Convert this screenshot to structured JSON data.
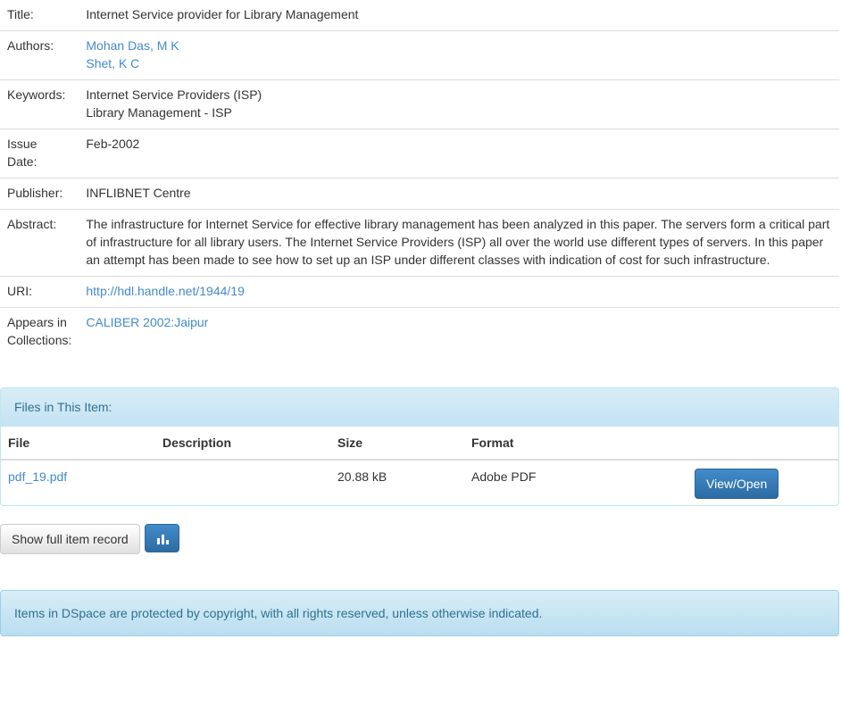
{
  "item": {
    "title_label": "Title:",
    "title": "Internet Service provider for Library Management",
    "authors_label": "Authors:",
    "authors": [
      "Mohan Das, M K",
      "Shet, K C"
    ],
    "keywords_label": "Keywords:",
    "keywords": [
      "Internet Service Providers (ISP)",
      "Library Management - ISP"
    ],
    "issue_date_label_1": "Issue",
    "issue_date_label_2": "Date:",
    "issue_date": "Feb-2002",
    "publisher_label": "Publisher:",
    "publisher": "INFLIBNET Centre",
    "abstract_label": "Abstract:",
    "abstract_lines": [
      "The infrastructure for Internet Service for effective library management has been analyzed in this paper. The servers form a critical part",
      "of infrastructure for all library users. The Internet Service Providers (ISP) all over the world use different types of servers. In this paper",
      "an attempt has been made to see how to set up an ISP under different classes with indication of cost for such infrastructure."
    ],
    "uri_label": "URI:",
    "uri": "http://hdl.handle.net/1944/19",
    "collections_label_1": "Appears in",
    "collections_label_2": "Collections:",
    "collection": "CALIBER 2002:Jaipur"
  },
  "files": {
    "heading": "Files in This Item:",
    "columns": {
      "file": "File",
      "description": "Description",
      "size": "Size",
      "format": "Format"
    },
    "rows": [
      {
        "file": "pdf_19.pdf",
        "description": "",
        "size": "20.88 kB",
        "format": "Adobe PDF",
        "action": "View/Open"
      }
    ]
  },
  "actions": {
    "full_record": "Show full item record",
    "stats_icon": "bar-chart-icon"
  },
  "footer": {
    "copyright": "Items in DSpace are protected by copyright, with all rights reserved, unless otherwise indicated."
  },
  "colors": {
    "link": "#428bca",
    "panel_text": "#31708f",
    "primary": "#428bca"
  }
}
